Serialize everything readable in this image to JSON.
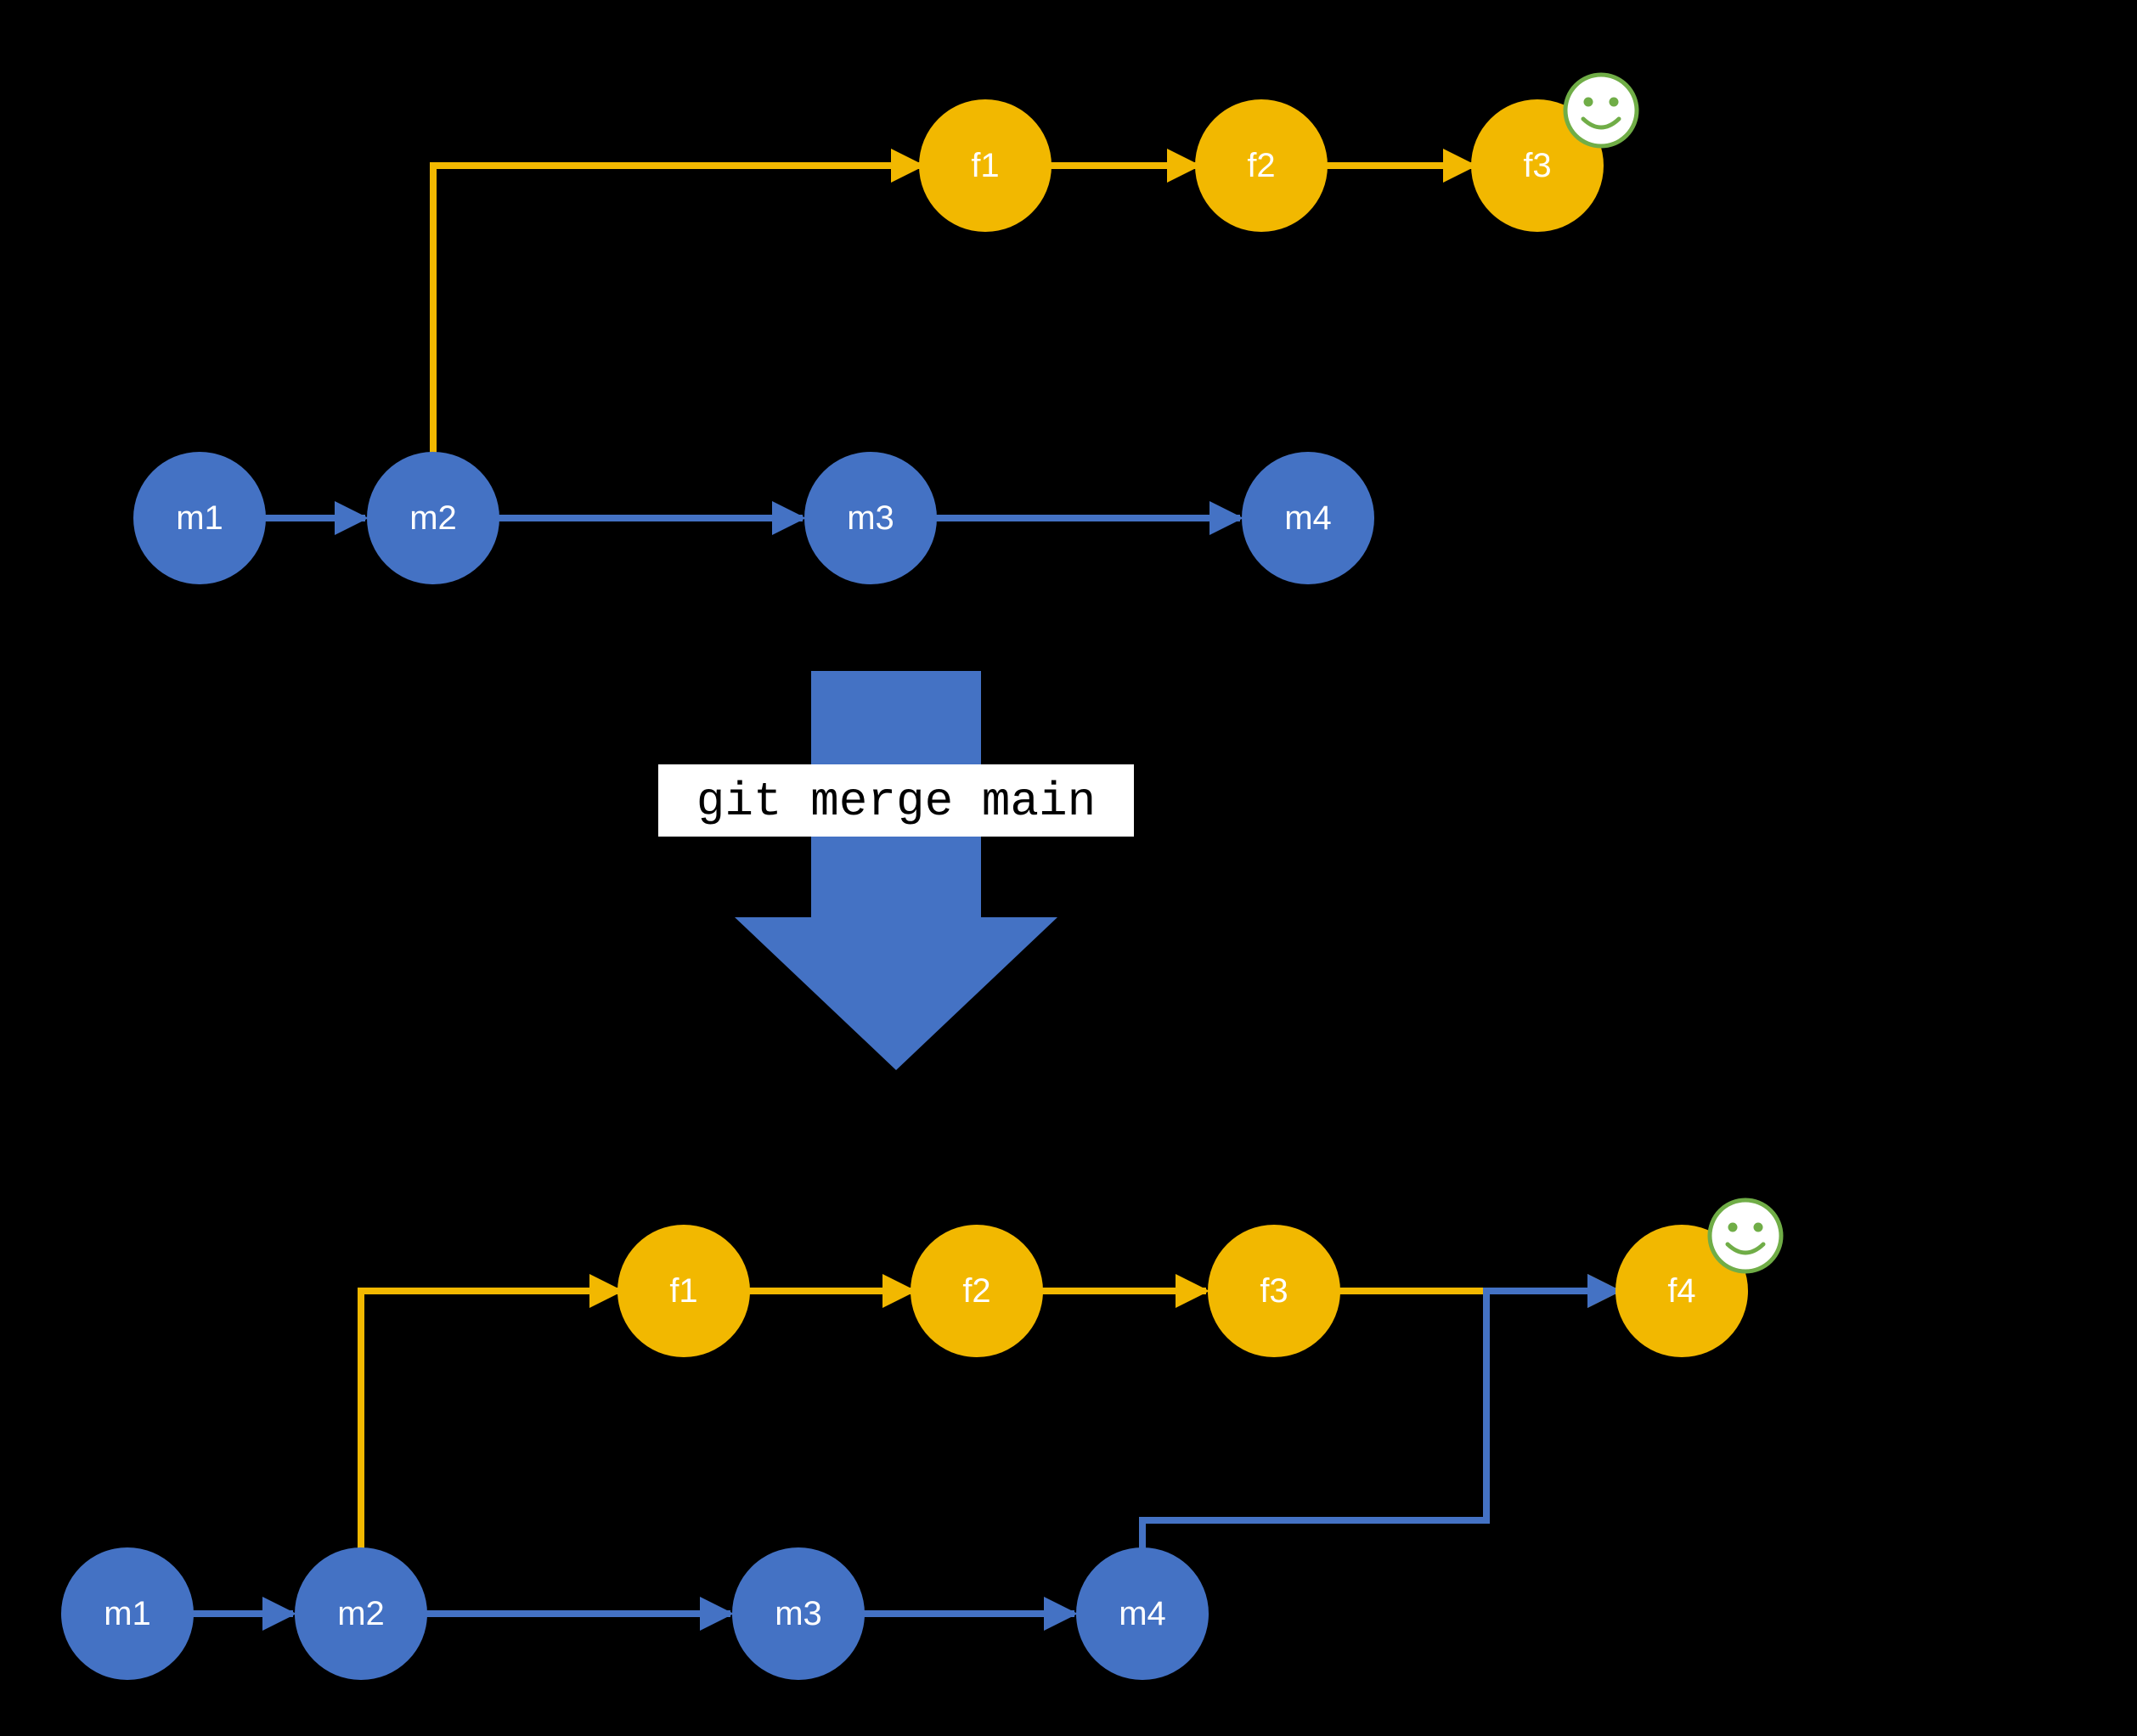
{
  "colors": {
    "main": "#4472c4",
    "feature": "#f2b800",
    "smiley": "#70AD47",
    "bg": "#000000",
    "cmd_bg": "#ffffff",
    "node_text": "#ffffff"
  },
  "command": "git merge main",
  "diagram": {
    "description": "Git merge diagram: before and after merging main into feature branch, producing merge commit f4.",
    "before": {
      "main": [
        "m1",
        "m2",
        "m3",
        "m4"
      ],
      "feature": [
        "f1",
        "f2",
        "f3"
      ],
      "branch_point": "m2",
      "head": "f3"
    },
    "after": {
      "main": [
        "m1",
        "m2",
        "m3",
        "m4"
      ],
      "feature": [
        "f1",
        "f2",
        "f3",
        "f4"
      ],
      "branch_point": "m2",
      "merge_commit": "f4",
      "merge_parents": [
        "f3",
        "m4"
      ],
      "head": "f4"
    }
  },
  "nodes": {
    "before": {
      "m1": {
        "label": "m1",
        "kind": "main"
      },
      "m2": {
        "label": "m2",
        "kind": "main"
      },
      "m3": {
        "label": "m3",
        "kind": "main"
      },
      "m4": {
        "label": "m4",
        "kind": "main"
      },
      "f1": {
        "label": "f1",
        "kind": "feature"
      },
      "f2": {
        "label": "f2",
        "kind": "feature"
      },
      "f3": {
        "label": "f3",
        "kind": "feature"
      }
    },
    "after": {
      "m1": {
        "label": "m1",
        "kind": "main"
      },
      "m2": {
        "label": "m2",
        "kind": "main"
      },
      "m3": {
        "label": "m3",
        "kind": "main"
      },
      "m4": {
        "label": "m4",
        "kind": "main"
      },
      "f1": {
        "label": "f1",
        "kind": "feature"
      },
      "f2": {
        "label": "f2",
        "kind": "feature"
      },
      "f3": {
        "label": "f3",
        "kind": "feature"
      },
      "f4": {
        "label": "f4",
        "kind": "feature"
      }
    }
  }
}
